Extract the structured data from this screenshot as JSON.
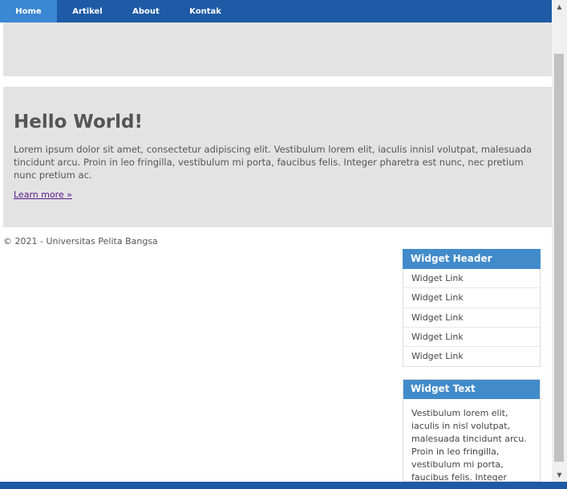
{
  "nav": {
    "items": [
      {
        "label": "Home",
        "active": true
      },
      {
        "label": "Artikel",
        "active": false
      },
      {
        "label": "About",
        "active": false
      },
      {
        "label": "Kontak",
        "active": false
      }
    ]
  },
  "hero": {
    "title": "Hello World!",
    "text": "Lorem ipsum dolor sit amet, consectetur adipiscing elit. Vestibulum lorem elit, iaculis innisl volutpat, malesuada tincidunt arcu. Proin in leo fringilla, vestibulum mi porta, faucibus felis. Integer pharetra est nunc, nec pretium nunc pretium ac.",
    "link": "Learn more »"
  },
  "footer": {
    "text": "© 2021 - Universitas Pelita Bangsa"
  },
  "sidebar": {
    "widget_links": {
      "header": "Widget Header",
      "links": [
        "Widget Link",
        "Widget Link",
        "Widget Link",
        "Widget Link",
        "Widget Link"
      ]
    },
    "widget_text": {
      "header": "Widget Text",
      "body": "Vestibulum lorem elit, iaculis in nisl volutpat, malesuada tincidunt arcu. Proin in leo fringilla, vestibulum mi porta, faucibus felis. Integer pharetra est nunc, nec"
    }
  },
  "colors": {
    "nav_bg": "#1e5aa5",
    "nav_active": "#3a87d3",
    "widget_header": "#428bca",
    "panel_bg": "#e3e3e3",
    "text": "#555555"
  }
}
